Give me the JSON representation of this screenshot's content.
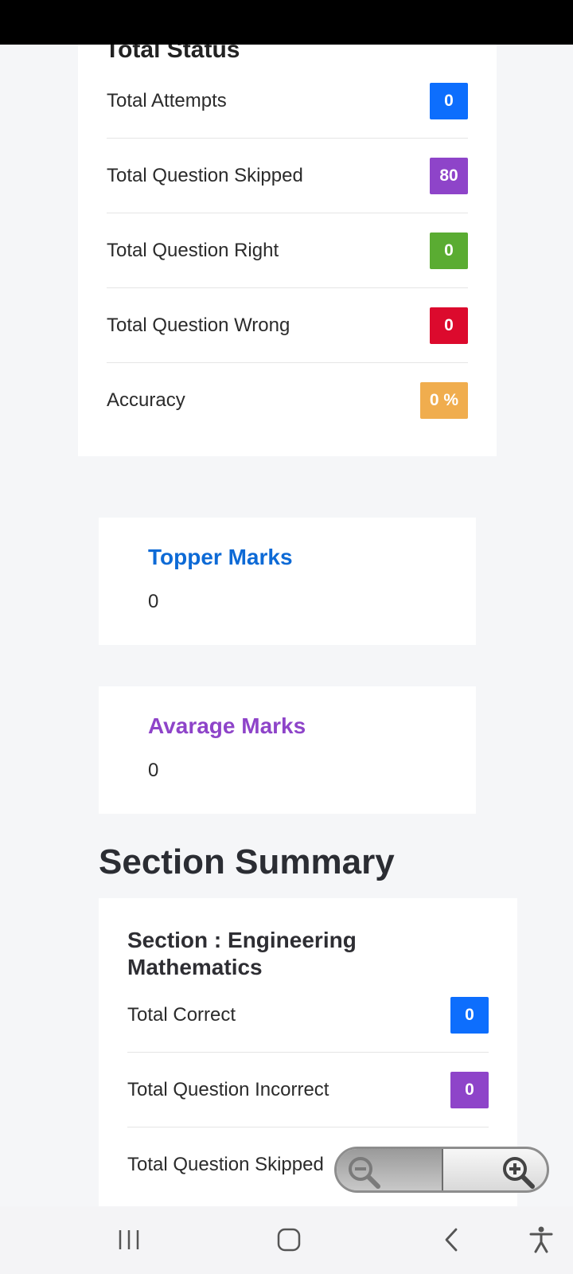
{
  "total_status": {
    "title": "Total Status",
    "rows": [
      {
        "label": "Total Attempts",
        "value": "0",
        "color": "#0d6efd"
      },
      {
        "label": "Total Question Skipped",
        "value": "80",
        "color": "#8e44c9"
      },
      {
        "label": "Total Question Right",
        "value": "0",
        "color": "#5aac32"
      },
      {
        "label": "Total Question Wrong",
        "value": "0",
        "color": "#dc0a2d"
      },
      {
        "label": "Accuracy",
        "value": "0 %",
        "color": "#f0ad4e"
      }
    ]
  },
  "topper": {
    "title": "Topper Marks",
    "value": "0",
    "color": "#0d6ad6"
  },
  "average": {
    "title": "Avarage Marks",
    "value": "0",
    "color": "#8e44c9"
  },
  "section_summary": {
    "heading": "Section Summary",
    "section_name": "Section : Engineering Mathematics",
    "rows": [
      {
        "label": "Total Correct",
        "value": "0",
        "color": "#0d6efd"
      },
      {
        "label": "Total Question Incorrect",
        "value": "0",
        "color": "#8e44c9"
      },
      {
        "label": "Total Question Skipped",
        "value": "",
        "color": "#5aac32"
      }
    ]
  },
  "zoom": {
    "out_icon": "zoom-out-icon",
    "in_icon": "zoom-in-icon"
  },
  "nav": {
    "recents_icon": "recents-icon",
    "home_icon": "home-icon",
    "back_icon": "back-icon",
    "accessibility_icon": "accessibility-icon"
  }
}
